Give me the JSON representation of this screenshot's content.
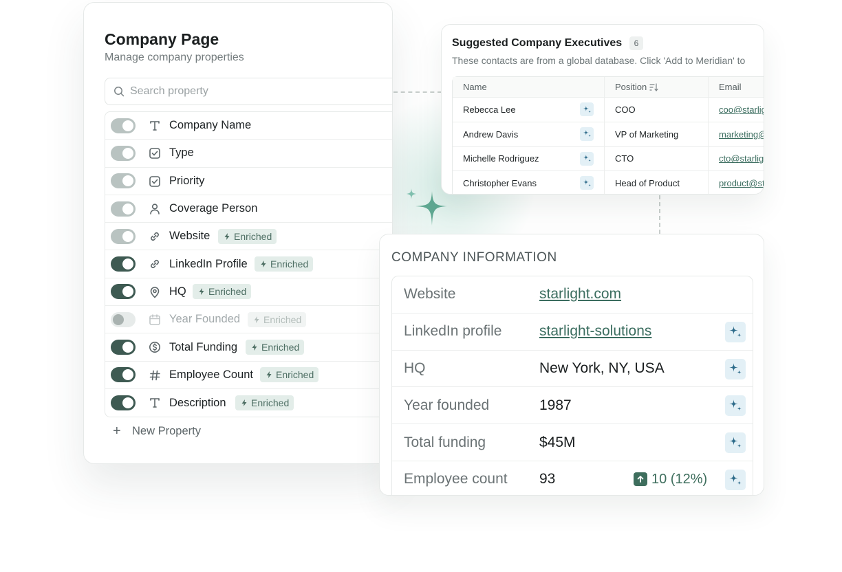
{
  "company_page": {
    "title": "Company Page",
    "subtitle": "Manage company properties",
    "search": {
      "placeholder": "Search property"
    },
    "properties": [
      {
        "label": "Company Name",
        "icon": "text-type-icon",
        "toggle": "locked",
        "badge": ""
      },
      {
        "label": "Type",
        "icon": "checkbox-icon",
        "toggle": "locked",
        "badge": ""
      },
      {
        "label": "Priority",
        "icon": "checkbox-icon",
        "toggle": "locked",
        "badge": ""
      },
      {
        "label": "Coverage Person",
        "icon": "person-icon",
        "toggle": "locked",
        "badge": ""
      },
      {
        "label": "Website",
        "icon": "link-icon",
        "toggle": "locked",
        "badge": "Enriched"
      },
      {
        "label": "LinkedIn Profile",
        "icon": "link-icon",
        "toggle": "on",
        "badge": "Enriched"
      },
      {
        "label": "HQ",
        "icon": "location-pin-icon",
        "toggle": "on",
        "badge": "Enriched"
      },
      {
        "label": "Year Founded",
        "icon": "calendar-icon",
        "toggle": "off",
        "badge": "Enriched"
      },
      {
        "label": "Total Funding",
        "icon": "dollar-icon",
        "toggle": "on",
        "badge": "Enriched"
      },
      {
        "label": "Employee Count",
        "icon": "hash-icon",
        "toggle": "on",
        "badge": "Enriched"
      },
      {
        "label": "Description",
        "icon": "text-type-icon",
        "toggle": "on",
        "badge": "Enriched"
      }
    ],
    "new_property_label": "New Property"
  },
  "executives": {
    "title": "Suggested Company Executives",
    "count": "6",
    "subtitle": "These contacts are from a global database. Click 'Add to Meridian' to",
    "columns": [
      "Name",
      "Position",
      "Email"
    ],
    "rows": [
      {
        "name": "Rebecca Lee",
        "position": "COO",
        "email": "coo@starlig"
      },
      {
        "name": "Andrew Davis",
        "position": "VP of Marketing",
        "email": "marketing@"
      },
      {
        "name": "Michelle Rodriguez",
        "position": "CTO",
        "email": "cto@starligh"
      },
      {
        "name": "Christopher Evans",
        "position": "Head of Product",
        "email": "product@st"
      }
    ]
  },
  "company_info": {
    "title": "COMPANY INFORMATION",
    "rows": [
      {
        "label": "Website",
        "value": "starlight.com"
      },
      {
        "label": "LinkedIn profile",
        "value": "starlight-solutions"
      },
      {
        "label": "HQ",
        "value": "New York, NY, USA"
      },
      {
        "label": "Year founded",
        "value": "1987"
      },
      {
        "label": "Total funding",
        "value": "$45M"
      },
      {
        "label": "Employee count",
        "value": "93"
      }
    ],
    "employee_growth": "10 (12%)"
  },
  "colors": {
    "accent_green": "#3e5a52",
    "link_green": "#3b6d5f",
    "badge_bg": "#e3ede9",
    "spark_bg": "#e3f0f6"
  }
}
